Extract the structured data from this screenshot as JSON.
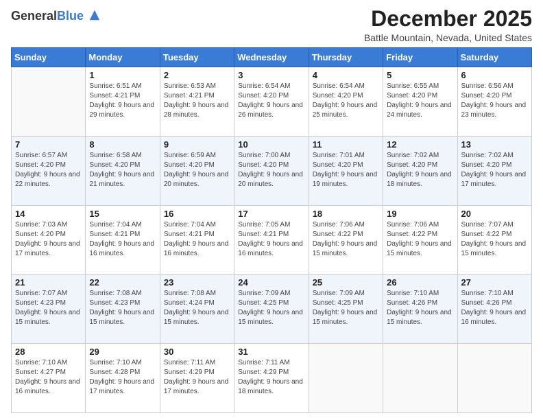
{
  "header": {
    "logo_general": "General",
    "logo_blue": "Blue",
    "title": "December 2025",
    "location": "Battle Mountain, Nevada, United States"
  },
  "days_of_week": [
    "Sunday",
    "Monday",
    "Tuesday",
    "Wednesday",
    "Thursday",
    "Friday",
    "Saturday"
  ],
  "weeks": [
    [
      {
        "day": "",
        "sunrise": "",
        "sunset": "",
        "daylight": ""
      },
      {
        "day": "1",
        "sunrise": "Sunrise: 6:51 AM",
        "sunset": "Sunset: 4:21 PM",
        "daylight": "Daylight: 9 hours and 29 minutes."
      },
      {
        "day": "2",
        "sunrise": "Sunrise: 6:53 AM",
        "sunset": "Sunset: 4:21 PM",
        "daylight": "Daylight: 9 hours and 28 minutes."
      },
      {
        "day": "3",
        "sunrise": "Sunrise: 6:54 AM",
        "sunset": "Sunset: 4:20 PM",
        "daylight": "Daylight: 9 hours and 26 minutes."
      },
      {
        "day": "4",
        "sunrise": "Sunrise: 6:54 AM",
        "sunset": "Sunset: 4:20 PM",
        "daylight": "Daylight: 9 hours and 25 minutes."
      },
      {
        "day": "5",
        "sunrise": "Sunrise: 6:55 AM",
        "sunset": "Sunset: 4:20 PM",
        "daylight": "Daylight: 9 hours and 24 minutes."
      },
      {
        "day": "6",
        "sunrise": "Sunrise: 6:56 AM",
        "sunset": "Sunset: 4:20 PM",
        "daylight": "Daylight: 9 hours and 23 minutes."
      }
    ],
    [
      {
        "day": "7",
        "sunrise": "Sunrise: 6:57 AM",
        "sunset": "Sunset: 4:20 PM",
        "daylight": "Daylight: 9 hours and 22 minutes."
      },
      {
        "day": "8",
        "sunrise": "Sunrise: 6:58 AM",
        "sunset": "Sunset: 4:20 PM",
        "daylight": "Daylight: 9 hours and 21 minutes."
      },
      {
        "day": "9",
        "sunrise": "Sunrise: 6:59 AM",
        "sunset": "Sunset: 4:20 PM",
        "daylight": "Daylight: 9 hours and 20 minutes."
      },
      {
        "day": "10",
        "sunrise": "Sunrise: 7:00 AM",
        "sunset": "Sunset: 4:20 PM",
        "daylight": "Daylight: 9 hours and 20 minutes."
      },
      {
        "day": "11",
        "sunrise": "Sunrise: 7:01 AM",
        "sunset": "Sunset: 4:20 PM",
        "daylight": "Daylight: 9 hours and 19 minutes."
      },
      {
        "day": "12",
        "sunrise": "Sunrise: 7:02 AM",
        "sunset": "Sunset: 4:20 PM",
        "daylight": "Daylight: 9 hours and 18 minutes."
      },
      {
        "day": "13",
        "sunrise": "Sunrise: 7:02 AM",
        "sunset": "Sunset: 4:20 PM",
        "daylight": "Daylight: 9 hours and 17 minutes."
      }
    ],
    [
      {
        "day": "14",
        "sunrise": "Sunrise: 7:03 AM",
        "sunset": "Sunset: 4:20 PM",
        "daylight": "Daylight: 9 hours and 17 minutes."
      },
      {
        "day": "15",
        "sunrise": "Sunrise: 7:04 AM",
        "sunset": "Sunset: 4:21 PM",
        "daylight": "Daylight: 9 hours and 16 minutes."
      },
      {
        "day": "16",
        "sunrise": "Sunrise: 7:04 AM",
        "sunset": "Sunset: 4:21 PM",
        "daylight": "Daylight: 9 hours and 16 minutes."
      },
      {
        "day": "17",
        "sunrise": "Sunrise: 7:05 AM",
        "sunset": "Sunset: 4:21 PM",
        "daylight": "Daylight: 9 hours and 16 minutes."
      },
      {
        "day": "18",
        "sunrise": "Sunrise: 7:06 AM",
        "sunset": "Sunset: 4:22 PM",
        "daylight": "Daylight: 9 hours and 15 minutes."
      },
      {
        "day": "19",
        "sunrise": "Sunrise: 7:06 AM",
        "sunset": "Sunset: 4:22 PM",
        "daylight": "Daylight: 9 hours and 15 minutes."
      },
      {
        "day": "20",
        "sunrise": "Sunrise: 7:07 AM",
        "sunset": "Sunset: 4:22 PM",
        "daylight": "Daylight: 9 hours and 15 minutes."
      }
    ],
    [
      {
        "day": "21",
        "sunrise": "Sunrise: 7:07 AM",
        "sunset": "Sunset: 4:23 PM",
        "daylight": "Daylight: 9 hours and 15 minutes."
      },
      {
        "day": "22",
        "sunrise": "Sunrise: 7:08 AM",
        "sunset": "Sunset: 4:23 PM",
        "daylight": "Daylight: 9 hours and 15 minutes."
      },
      {
        "day": "23",
        "sunrise": "Sunrise: 7:08 AM",
        "sunset": "Sunset: 4:24 PM",
        "daylight": "Daylight: 9 hours and 15 minutes."
      },
      {
        "day": "24",
        "sunrise": "Sunrise: 7:09 AM",
        "sunset": "Sunset: 4:25 PM",
        "daylight": "Daylight: 9 hours and 15 minutes."
      },
      {
        "day": "25",
        "sunrise": "Sunrise: 7:09 AM",
        "sunset": "Sunset: 4:25 PM",
        "daylight": "Daylight: 9 hours and 15 minutes."
      },
      {
        "day": "26",
        "sunrise": "Sunrise: 7:10 AM",
        "sunset": "Sunset: 4:26 PM",
        "daylight": "Daylight: 9 hours and 15 minutes."
      },
      {
        "day": "27",
        "sunrise": "Sunrise: 7:10 AM",
        "sunset": "Sunset: 4:26 PM",
        "daylight": "Daylight: 9 hours and 16 minutes."
      }
    ],
    [
      {
        "day": "28",
        "sunrise": "Sunrise: 7:10 AM",
        "sunset": "Sunset: 4:27 PM",
        "daylight": "Daylight: 9 hours and 16 minutes."
      },
      {
        "day": "29",
        "sunrise": "Sunrise: 7:10 AM",
        "sunset": "Sunset: 4:28 PM",
        "daylight": "Daylight: 9 hours and 17 minutes."
      },
      {
        "day": "30",
        "sunrise": "Sunrise: 7:11 AM",
        "sunset": "Sunset: 4:29 PM",
        "daylight": "Daylight: 9 hours and 17 minutes."
      },
      {
        "day": "31",
        "sunrise": "Sunrise: 7:11 AM",
        "sunset": "Sunset: 4:29 PM",
        "daylight": "Daylight: 9 hours and 18 minutes."
      },
      {
        "day": "",
        "sunrise": "",
        "sunset": "",
        "daylight": ""
      },
      {
        "day": "",
        "sunrise": "",
        "sunset": "",
        "daylight": ""
      },
      {
        "day": "",
        "sunrise": "",
        "sunset": "",
        "daylight": ""
      }
    ]
  ]
}
